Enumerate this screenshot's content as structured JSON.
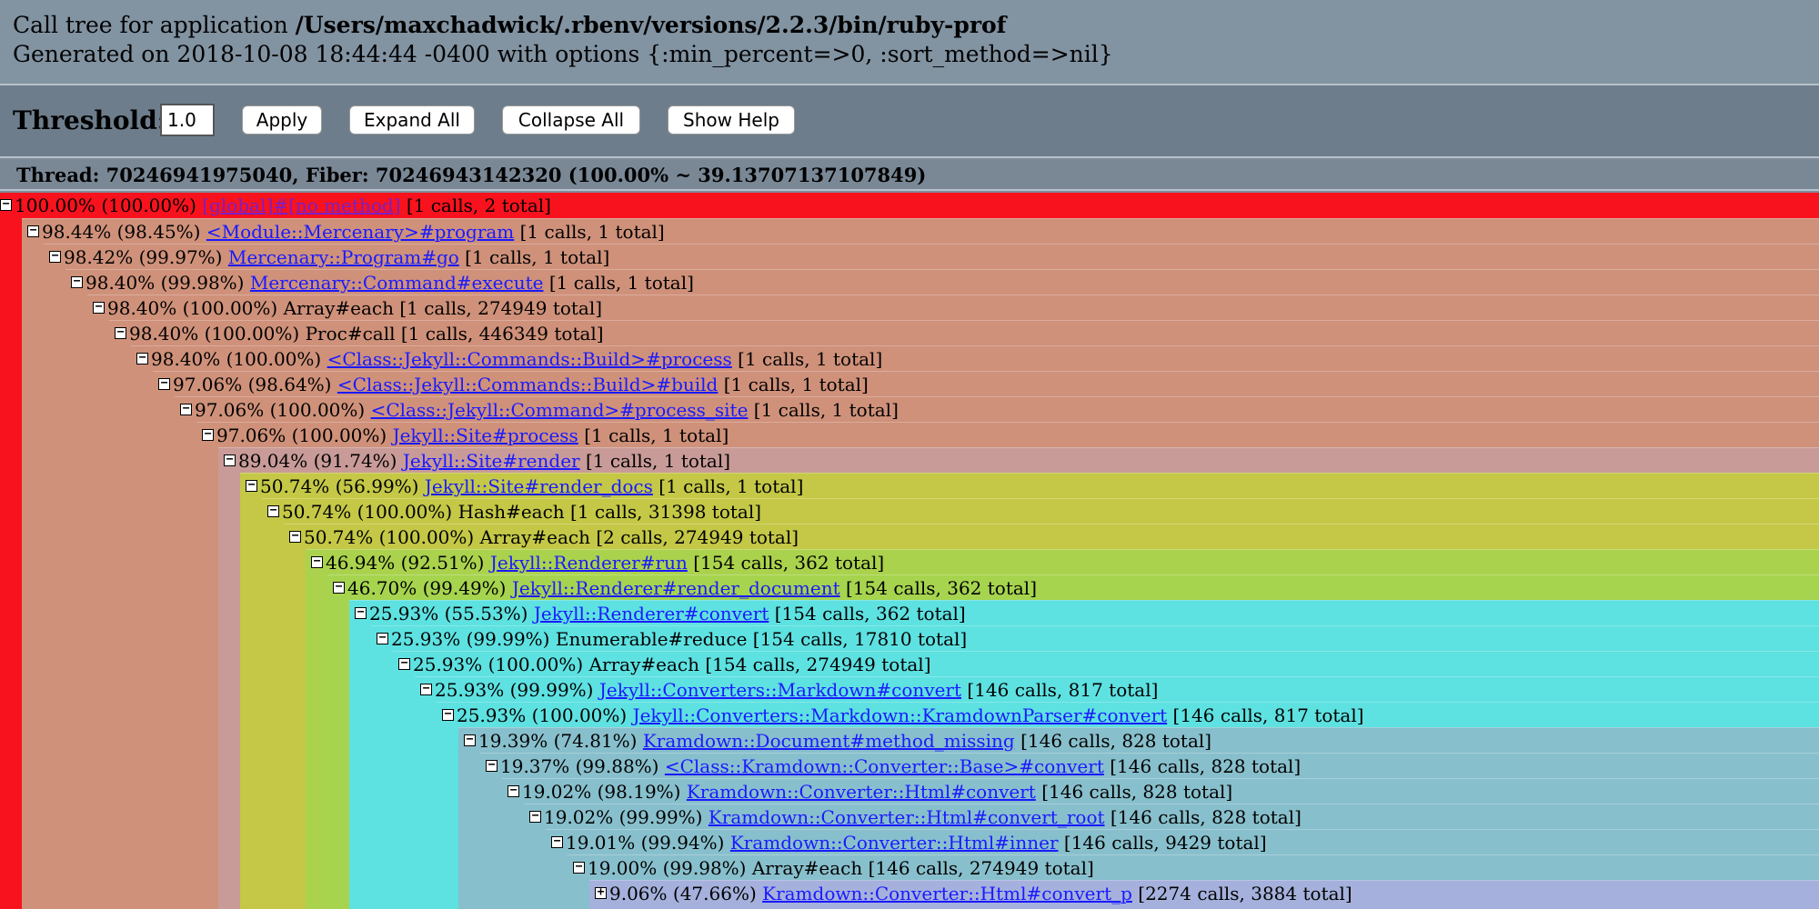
{
  "header": {
    "title_prefix": "Call tree for application ",
    "app_path": "/Users/maxchadwick/.rbenv/versions/2.2.3/bin/ruby-prof",
    "generated": "Generated on 2018-10-08 18:44:44 -0400 with options {:min_percent=>0, :sort_method=>nil}"
  },
  "controls": {
    "threshold_label": "Threshold:",
    "threshold_value": "1.0",
    "apply_label": "Apply",
    "expand_label": "Expand All",
    "collapse_label": "Collapse All",
    "help_label": "Show Help"
  },
  "thread": {
    "label": "Thread: 70246941975040, Fiber: 70246943142320 (100.00% ~ 39.13707137107849)"
  },
  "tree_rows": [
    {
      "pct": "100.00% (100.00%)",
      "method": "[global]#[no method]",
      "link": true,
      "visited": true,
      "stats": "[1 calls, 2 total]",
      "color": "#f8121d",
      "toggle": "−"
    },
    {
      "pct": "98.44% (98.45%)",
      "method": "<Module::Mercenary>#program",
      "link": true,
      "stats": "[1 calls, 1 total]",
      "color": "#cf917a",
      "toggle": "−"
    },
    {
      "pct": "98.42% (99.97%)",
      "method": "Mercenary::Program#go",
      "link": true,
      "stats": "[1 calls, 1 total]",
      "color": "#cf917a",
      "toggle": "−"
    },
    {
      "pct": "98.40% (99.98%)",
      "method": "Mercenary::Command#execute",
      "link": true,
      "stats": "[1 calls, 1 total]",
      "color": "#cf917a",
      "toggle": "−"
    },
    {
      "pct": "98.40% (100.00%)",
      "method": "Array#each",
      "link": false,
      "stats": "[1 calls, 274949 total]",
      "color": "#cf917a",
      "toggle": "−"
    },
    {
      "pct": "98.40% (100.00%)",
      "method": "Proc#call",
      "link": false,
      "stats": "[1 calls, 446349 total]",
      "color": "#cf917a",
      "toggle": "−"
    },
    {
      "pct": "98.40% (100.00%)",
      "method": "<Class::Jekyll::Commands::Build>#process",
      "link": true,
      "stats": "[1 calls, 1 total]",
      "color": "#cf917a",
      "toggle": "−"
    },
    {
      "pct": "97.06% (98.64%)",
      "method": "<Class::Jekyll::Commands::Build>#build",
      "link": true,
      "stats": "[1 calls, 1 total]",
      "color": "#cf917a",
      "toggle": "−"
    },
    {
      "pct": "97.06% (100.00%)",
      "method": "<Class::Jekyll::Command>#process_site",
      "link": true,
      "stats": "[1 calls, 1 total]",
      "color": "#cf917a",
      "toggle": "−"
    },
    {
      "pct": "97.06% (100.00%)",
      "method": "Jekyll::Site#process",
      "link": true,
      "stats": "[1 calls, 1 total]",
      "color": "#cf917a",
      "toggle": "−"
    },
    {
      "pct": "89.04% (91.74%)",
      "method": "Jekyll::Site#render",
      "link": true,
      "stats": "[1 calls, 1 total]",
      "color": "#c89b98",
      "toggle": "−"
    },
    {
      "pct": "50.74% (56.99%)",
      "method": "Jekyll::Site#render_docs",
      "link": true,
      "stats": "[1 calls, 1 total]",
      "color": "#c4c846",
      "toggle": "−"
    },
    {
      "pct": "50.74% (100.00%)",
      "method": "Hash#each",
      "link": false,
      "stats": "[1 calls, 31398 total]",
      "color": "#c4c846",
      "toggle": "−"
    },
    {
      "pct": "50.74% (100.00%)",
      "method": "Array#each",
      "link": false,
      "stats": "[2 calls, 274949 total]",
      "color": "#c4c846",
      "toggle": "−"
    },
    {
      "pct": "46.94% (92.51%)",
      "method": "Jekyll::Renderer#run",
      "link": true,
      "stats": "[154 calls, 362 total]",
      "color": "#abd24c",
      "toggle": "−"
    },
    {
      "pct": "46.70% (99.49%)",
      "method": "Jekyll::Renderer#render_document",
      "link": true,
      "stats": "[154 calls, 362 total]",
      "color": "#a6d44e",
      "toggle": "−"
    },
    {
      "pct": "25.93% (55.53%)",
      "method": "Jekyll::Renderer#convert",
      "link": true,
      "stats": "[154 calls, 362 total]",
      "color": "#5ee1e1",
      "toggle": "−"
    },
    {
      "pct": "25.93% (99.99%)",
      "method": "Enumerable#reduce",
      "link": false,
      "stats": "[154 calls, 17810 total]",
      "color": "#5ee1e1",
      "toggle": "−"
    },
    {
      "pct": "25.93% (100.00%)",
      "method": "Array#each",
      "link": false,
      "stats": "[154 calls, 274949 total]",
      "color": "#5ee1e1",
      "toggle": "−"
    },
    {
      "pct": "25.93% (99.99%)",
      "method": "Jekyll::Converters::Markdown#convert",
      "link": true,
      "stats": "[146 calls, 817 total]",
      "color": "#5ee1e1",
      "toggle": "−"
    },
    {
      "pct": "25.93% (100.00%)",
      "method": "Jekyll::Converters::Markdown::KramdownParser#convert",
      "link": true,
      "stats": "[146 calls, 817 total]",
      "color": "#5ee1e1",
      "toggle": "−"
    },
    {
      "pct": "19.39% (74.81%)",
      "method": "Kramdown::Document#method_missing",
      "link": true,
      "stats": "[146 calls, 828 total]",
      "color": "#88bfcc",
      "toggle": "−"
    },
    {
      "pct": "19.37% (99.88%)",
      "method": "<Class::Kramdown::Converter::Base>#convert",
      "link": true,
      "stats": "[146 calls, 828 total]",
      "color": "#88bfcc",
      "toggle": "−"
    },
    {
      "pct": "19.02% (98.19%)",
      "method": "Kramdown::Converter::Html#convert",
      "link": true,
      "stats": "[146 calls, 828 total]",
      "color": "#88bfcc",
      "toggle": "−"
    },
    {
      "pct": "19.02% (99.99%)",
      "method": "Kramdown::Converter::Html#convert_root",
      "link": true,
      "stats": "[146 calls, 828 total]",
      "color": "#88bfcc",
      "toggle": "−"
    },
    {
      "pct": "19.01% (99.94%)",
      "method": "Kramdown::Converter::Html#inner",
      "link": true,
      "stats": "[146 calls, 9429 total]",
      "color": "#88bfcc",
      "toggle": "−"
    },
    {
      "pct": "19.00% (99.98%)",
      "method": "Array#each",
      "link": false,
      "stats": "[146 calls, 274949 total]",
      "color": "#88bfcc",
      "toggle": "−"
    },
    {
      "pct": "9.06% (47.66%)",
      "method": "Kramdown::Converter::Html#convert_p",
      "link": true,
      "stats": "[2274 calls, 3884 total]",
      "color": "#a5b1dc",
      "toggle": "+"
    }
  ]
}
